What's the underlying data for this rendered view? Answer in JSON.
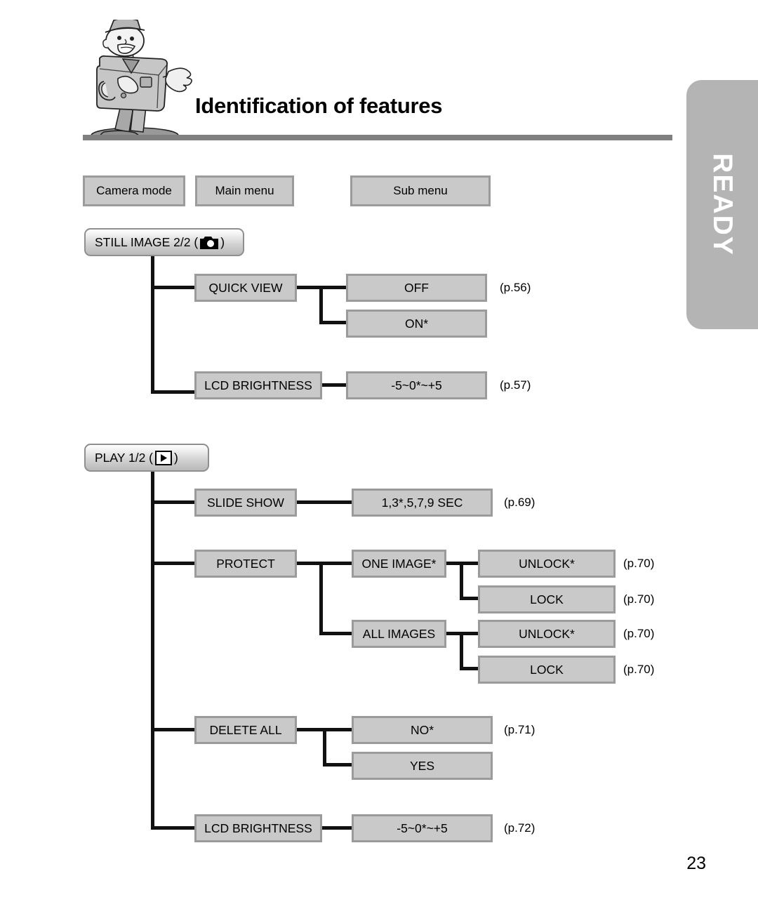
{
  "header": {
    "title": "Identification of features",
    "mascot_icon": "camera-mascot-illustration"
  },
  "side_tab": {
    "label": "READY",
    "color": "#b4b4b4",
    "text_color": "#ffffff"
  },
  "legend": {
    "camera_mode": "Camera mode",
    "main_menu": "Main menu",
    "sub_menu": "Sub menu"
  },
  "colors": {
    "box_fill": "#c9c9c9",
    "box_border": "#9b9b9b",
    "line": "#111111",
    "rule": "#808080"
  },
  "diagram": {
    "groups": [
      {
        "mode_label": "STILL IMAGE 2/2 (",
        "mode_label_tail": ")",
        "mode_icon": "camera-icon",
        "items": [
          {
            "label": "QUICK VIEW",
            "subs": [
              {
                "label": "OFF",
                "page": "(p.56)"
              },
              {
                "label": "ON*",
                "page": ""
              }
            ]
          },
          {
            "label": "LCD BRIGHTNESS",
            "subs": [
              {
                "label": "-5~0*~+5",
                "page": "(p.57)"
              }
            ]
          }
        ]
      },
      {
        "mode_label": "PLAY 1/2 (",
        "mode_label_tail": ")",
        "mode_icon": "play-icon",
        "items": [
          {
            "label": "SLIDE SHOW",
            "subs": [
              {
                "label": "1,3*,5,7,9 SEC",
                "page": "(p.69)"
              }
            ]
          },
          {
            "label": "PROTECT",
            "subs": [
              {
                "label": "ONE IMAGE*",
                "subsubs": [
                  {
                    "label": "UNLOCK*",
                    "page": "(p.70)"
                  },
                  {
                    "label": "LOCK",
                    "page": "(p.70)"
                  }
                ]
              },
              {
                "label": "ALL IMAGES",
                "subsubs": [
                  {
                    "label": "UNLOCK*",
                    "page": "(p.70)"
                  },
                  {
                    "label": "LOCK",
                    "page": "(p.70)"
                  }
                ]
              }
            ]
          },
          {
            "label": "DELETE ALL",
            "subs": [
              {
                "label": "NO*",
                "page": "(p.71)"
              },
              {
                "label": "YES",
                "page": ""
              }
            ]
          },
          {
            "label": "LCD BRIGHTNESS",
            "subs": [
              {
                "label": "-5~0*~+5",
                "page": "(p.72)"
              }
            ]
          }
        ]
      }
    ]
  },
  "footer": {
    "page_number": "23"
  }
}
